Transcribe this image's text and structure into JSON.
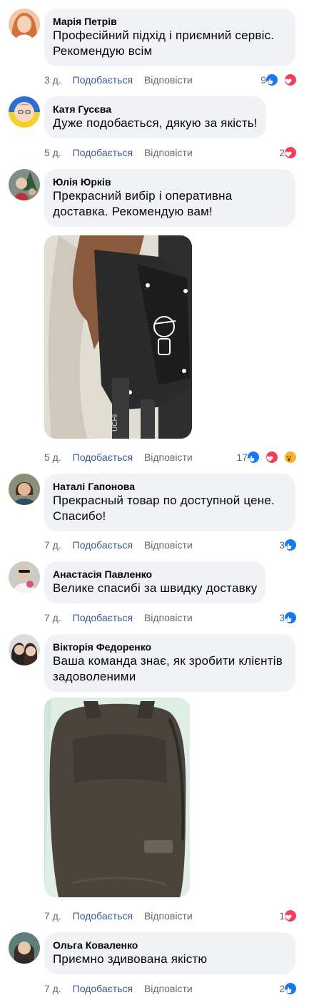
{
  "actions": {
    "like": "Подобається",
    "reply": "Відповісти"
  },
  "colors": {
    "like_blue": "#1877f2",
    "love_red": "#f33e58",
    "wow_yellow": "#f7b125"
  },
  "comments": [
    {
      "author": "Марія Петрів",
      "text": "Професійний підхід і приємний сервіс. Рекомендую всім",
      "time": "3 д.",
      "reaction_count": "9",
      "reactions": [
        "like-icon",
        "love-icon"
      ]
    },
    {
      "author": "Катя Гусєва",
      "text": "Дуже подобається, дякую за якість!",
      "time": "5 д.",
      "reaction_count": "2",
      "reactions": [
        "love-icon"
      ]
    },
    {
      "author": "Юлія Юрків",
      "text": "Прекрасний вибір і оперативна доставка. Рекомендую вам!",
      "time": "5 д.",
      "reaction_count": "17",
      "reactions": [
        "like-icon",
        "love-icon",
        "wow-icon"
      ]
    },
    {
      "author": "Наталі Гапонова",
      "text": "Прекрасный товар по доступной цене. Спасибо!",
      "time": "7 д.",
      "reaction_count": "3",
      "reactions": [
        "like-icon"
      ]
    },
    {
      "author": "Анастасія Павленко",
      "text": "Велике спасибі за швидку доставку",
      "time": "7 д.",
      "reaction_count": "3",
      "reactions": [
        "like-icon"
      ]
    },
    {
      "author": "Вікторія Федоренко",
      "text": "Ваша команда знає, як зробити клієнтів задоволеними",
      "time": "7 д.",
      "reaction_count": "1",
      "reactions": [
        "love-icon"
      ]
    },
    {
      "author": "Ольга Коваленко",
      "text": "Приємно здивована якістю",
      "time": "7 д.",
      "reaction_count": "2",
      "reactions": [
        "like-icon"
      ]
    }
  ]
}
